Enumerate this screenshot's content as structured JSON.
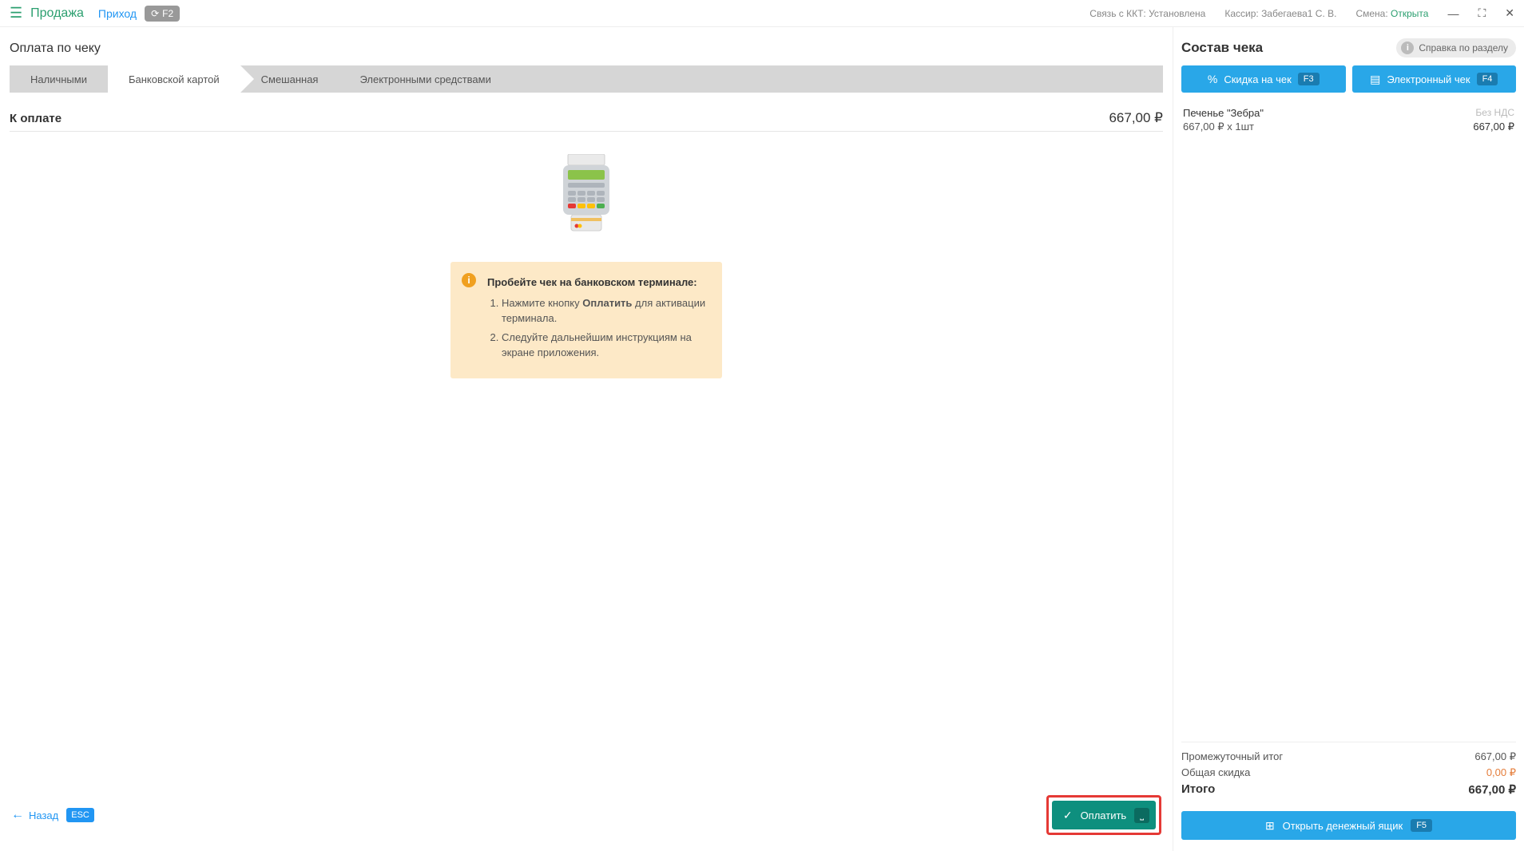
{
  "topbar": {
    "sale": "Продажа",
    "income": "Приход",
    "f2": "F2",
    "kkt_label": "Связь с ККТ:",
    "kkt_value": "Установлена",
    "cashier_label": "Кассир:",
    "cashier_value": "Забегаева1 С. В.",
    "shift_label": "Смена:",
    "shift_value": "Открыта"
  },
  "page_title": "Оплата по чеку",
  "tabs": {
    "cash": "Наличными",
    "card": "Банковской картой",
    "mixed": "Смешанная",
    "electronic": "Электронными средствами"
  },
  "payment": {
    "to_pay_label": "К оплате",
    "to_pay_amount": "667,00 ₽"
  },
  "info": {
    "heading": "Пробейте чек на банковском терминале:",
    "step1_prefix": "Нажмите кнопку ",
    "step1_bold": "Оплатить",
    "step1_suffix": " для активации терминала.",
    "step2": "Следуйте дальнейшим инструкциям на экране приложения."
  },
  "footer": {
    "back": "Назад",
    "esc": "ESC",
    "pay": "Оплатить",
    "pay_key": "⎵"
  },
  "sidebar": {
    "title": "Состав чека",
    "help": "Справка по разделу",
    "discount_btn": "Скидка на чек",
    "discount_key": "F3",
    "echeck_btn": "Электронный чек",
    "echeck_key": "F4",
    "items": [
      {
        "name": "Печенье \"Зебра\"",
        "vat": "Без НДС",
        "qty": "667,00 ₽ x 1шт",
        "sum": "667,00 ₽"
      }
    ],
    "totals": {
      "subtotal_label": "Промежуточный итог",
      "subtotal_value": "667,00 ₽",
      "discount_label": "Общая скидка",
      "discount_value": "0,00 ₽",
      "grand_label": "Итого",
      "grand_value": "667,00 ₽"
    },
    "drawer_btn": "Открыть денежный ящик",
    "drawer_key": "F5"
  }
}
